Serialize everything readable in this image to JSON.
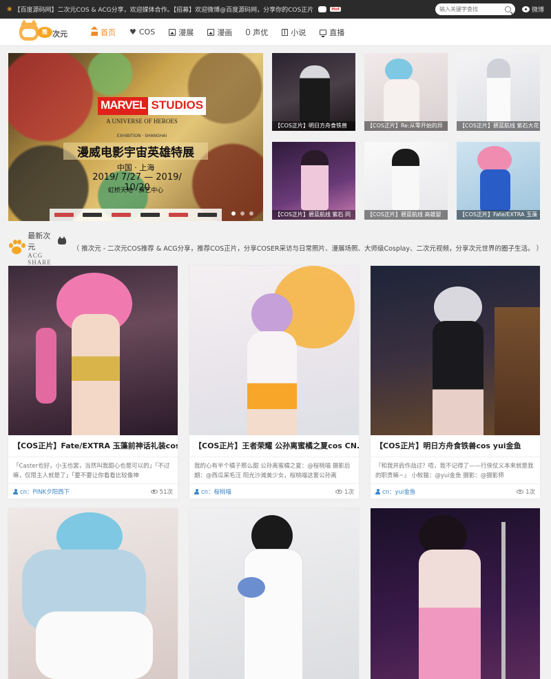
{
  "topbar": {
    "notice": "【百度源码网】二次元COS & ACG分享，欢迎媒体合作。【招募】欢迎微博@百度源码网，分享你的COS正片",
    "hot": "Hot",
    "search_placeholder": "输入关键字查找",
    "weibo_label": "微博"
  },
  "logo": {
    "badge": "推",
    "text": "次元"
  },
  "nav": {
    "items": [
      {
        "label": "首页",
        "icon": "home-icon"
      },
      {
        "label": "COS",
        "icon": "heart-icon"
      },
      {
        "label": "漫展",
        "icon": "image-icon"
      },
      {
        "label": "漫画",
        "icon": "image-icon"
      },
      {
        "label": "声优",
        "icon": "mic-icon"
      },
      {
        "label": "小说",
        "icon": "book-icon"
      },
      {
        "label": "直播",
        "icon": "tv-icon"
      }
    ]
  },
  "banner": {
    "brand_left": "MARVEL",
    "brand_right": "STUDIOS",
    "subtitle": "A UNIVERSE OF HEROES",
    "subtitle2": "EXHIBITION · SHANGHAI",
    "title": "漫威电影宇宙英雄特展",
    "city": "中国 · 上海",
    "dates": "2019/ 7/27 — 2019/ 10/20",
    "venue": "虹桥天地 · 演艺中心"
  },
  "thumbs": [
    {
      "caption": "【COS正片】明日方舟食铁兽"
    },
    {
      "caption": "【COS正片】Re:从零开始的异"
    },
    {
      "caption": "【COS正片】碧蓝航线 紫石大花"
    },
    {
      "caption": "【COS正片】碧蓝航线 紫石 同"
    },
    {
      "caption": "【COS正片】碧蓝航线 高雄婴"
    },
    {
      "caption": "【COS正片】Fate/EXTRA 玉藻"
    }
  ],
  "section": {
    "title": "最新次元",
    "sub": "ACG SHARE",
    "desc": "（ 推次元 - 二次元COS推荐 & ACG分享，推荐COS正片，分享COSER采访与日常照片、漫展场照、大师级Cosplay、二次元视频，分享次元世界的圈子生活。 ）"
  },
  "cards": [
    {
      "title": "【COS正片】Fate/EXTRA 玉藻前神话礼装cos ...",
      "excerpt": "「Caster也好，小玉也罢，当然叫我甜心也是可以的」「不过嘛，仅限主人就是了」「要不要让你看看比较像神",
      "author": "cn：PINK夕阳西下",
      "views": "51次"
    },
    {
      "title": "【COS正片】王者荣耀 公孙离蜜橘之夏cos CN...",
      "excerpt": "我的心有半个橘子那么甜 公孙离蜜橘之夏：@桜桃喵 摄影后期：@西瓜呆毛汪 阳光沙滩美少女，桜桃喵这套公孙离",
      "author": "cn：桜桃喵",
      "views": "1次"
    },
    {
      "title": "【COS正片】明日方舟食铁兽cos yui金鱼",
      "excerpt": "『和我并肩作战过？唔，我不记得了——行侠仗义本来就是我的职责嘛~』 小鲛猫：@yui金鱼 摄影：@摄影师",
      "author": "cn：yui金鱼",
      "views": "1次"
    }
  ]
}
